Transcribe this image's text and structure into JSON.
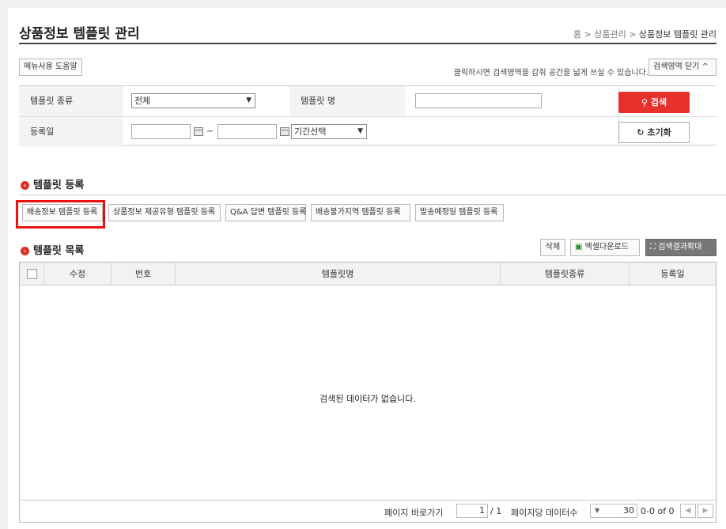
{
  "header": {
    "title": "상품정보 템플릿 관리",
    "breadcrumb": {
      "home": "홈",
      "sep": ">",
      "parent": "상품관리",
      "current": "상품정보 템플릿 관리"
    }
  },
  "toolbar": {
    "help_label": "메뉴사용 도움말",
    "hint": "클릭하시면 검색영역을 감춰 공간을 넓게 쓰실 수 있습니다.",
    "collapse_label": "검색영역 닫기 ^"
  },
  "search": {
    "type_label": "템플릿 종류",
    "type_value": "전체",
    "name_label": "템플릿 명",
    "name_value": "",
    "date_label": "등록일",
    "date_sep": "~",
    "period_value": "기간선택",
    "search_button": "검색",
    "search_icon": "search-icon",
    "reset_button": "초기화",
    "reset_icon": "refresh-icon"
  },
  "register": {
    "section_title": "템플릿 등록",
    "buttons": [
      "배송정보 템플릿 등록",
      "상품정보 제공유형 템플릿 등록",
      "Q&A 답변 템플릿 등록",
      "배송불가지역 템플릿 등록",
      "발송예정일 템플릿 등록"
    ]
  },
  "list": {
    "section_title": "템플릿 목록",
    "delete_button": "삭제",
    "excel_button": "엑셀다운로드",
    "expand_button": "검색결과확대",
    "columns": [
      "수정",
      "번호",
      "템플릿명",
      "템플릿종류",
      "등록일"
    ],
    "empty_message": "검색된 데이터가 없습니다.",
    "footer": {
      "goto_label": "페이지 바로가기",
      "page_value": "1",
      "page_total": "/ 1",
      "per_page_label": "페이지당 데이터수",
      "per_page_value": "30",
      "range": "0-0 of 0"
    }
  },
  "colors": {
    "accent": "#e8302c",
    "highlight": "#ee1111"
  }
}
